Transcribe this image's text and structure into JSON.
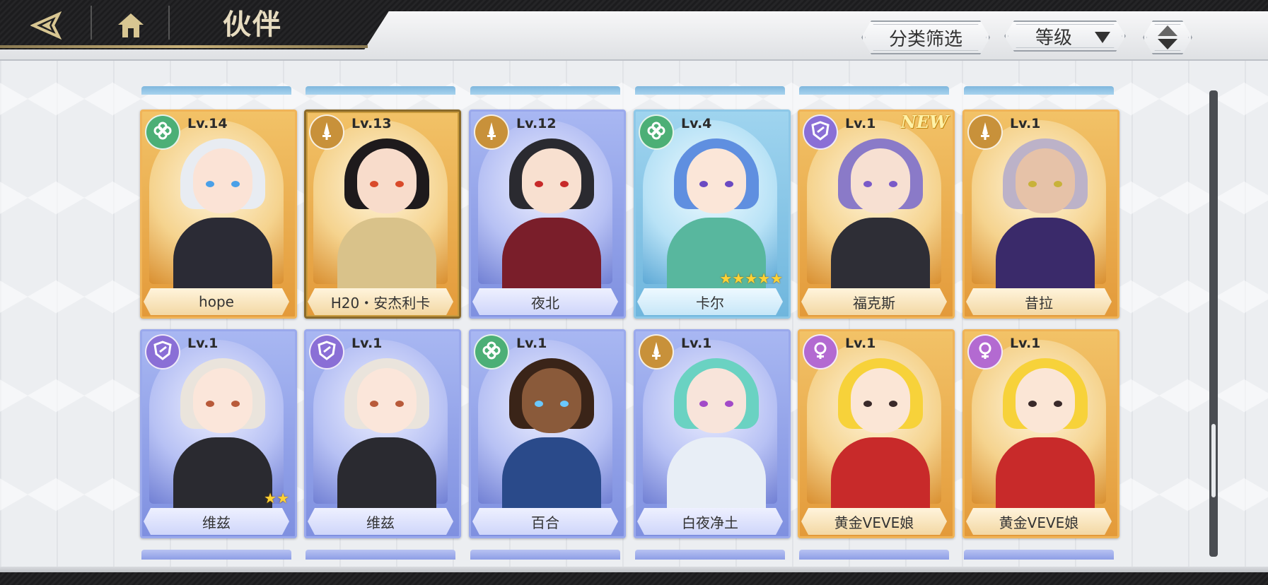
{
  "header": {
    "title": "伙伴",
    "filter_label": "分类筛选",
    "sort_label": "等级",
    "back_icon": "back-arrow-icon",
    "home_icon": "home-icon",
    "order_icon": "sort-order-icon"
  },
  "colors": {
    "gold_card": "#e9a84a",
    "blue_card": "#8e9ee6",
    "cyan_card": "#7fbfe3",
    "badge_green": "#4caf76",
    "badge_gold": "#c8913a",
    "badge_purple": "#8a6fd6",
    "badge_pink": "#b36ad1"
  },
  "partners": {
    "row1": [
      {
        "name": "hope",
        "level": "Lv.14",
        "rarity": "gold",
        "class_icon": "clover-icon",
        "hair": "#e8ecf2",
        "skin": "#fbe3d6",
        "body": "#2b2b35",
        "eyes": "#4aa0e8"
      },
      {
        "name": "H20・安杰利卡",
        "level": "Lv.13",
        "rarity": "gold",
        "class_icon": "sword-icon",
        "hair": "#1e1a1c",
        "skin": "#f8dccb",
        "body": "#d9c28a",
        "eyes": "#d94a2a"
      },
      {
        "name": "夜北",
        "level": "Lv.12",
        "rarity": "blue",
        "class_icon": "sword-icon",
        "hair": "#2a2a30",
        "skin": "#f8e0d0",
        "body": "#7a1e2a",
        "eyes": "#c72a2a"
      },
      {
        "name": "卡尔",
        "level": "Lv.4",
        "rarity": "cyan",
        "class_icon": "clover-icon",
        "hair": "#5f8fe0",
        "skin": "#fbe6d8",
        "body": "#58b79e",
        "eyes": "#6a4ac2",
        "stars": "★★★★★"
      },
      {
        "name": "福克斯",
        "level": "Lv.1",
        "rarity": "gold",
        "class_icon": "shield-icon",
        "hair": "#8a7ac8",
        "skin": "#f7e0d2",
        "body": "#2e2e36",
        "eyes": "#7a5ac8",
        "new": "NEW"
      },
      {
        "name": "昔拉",
        "level": "Lv.1",
        "rarity": "gold",
        "class_icon": "sword-icon",
        "hair": "#bcb2c8",
        "skin": "#e6c2a8",
        "body": "#3a2a6a",
        "eyes": "#c8b23a"
      }
    ],
    "row2": [
      {
        "name": "维兹",
        "level": "Lv.1",
        "rarity": "blue",
        "class_icon": "shield-icon",
        "hair": "#eae4dc",
        "skin": "#fbe6da",
        "body": "#2a2a30",
        "eyes": "#b85a3a",
        "stars": "★★"
      },
      {
        "name": "维兹",
        "level": "Lv.1",
        "rarity": "blue",
        "class_icon": "shield-icon",
        "hair": "#eae4dc",
        "skin": "#fbe6da",
        "body": "#2a2a30",
        "eyes": "#b85a3a"
      },
      {
        "name": "百合",
        "level": "Lv.1",
        "rarity": "blue",
        "class_icon": "clover-icon",
        "hair": "#3a2418",
        "skin": "#8a5a3a",
        "body": "#2a4a8a",
        "eyes": "#6ac8ff"
      },
      {
        "name": "白夜净土",
        "level": "Lv.1",
        "rarity": "blue",
        "class_icon": "sword-icon",
        "hair": "#6ad2c2",
        "skin": "#f8e4da",
        "body": "#e8eef6",
        "eyes": "#a24ac8"
      },
      {
        "name": "黄金VEVE娘",
        "level": "Lv.1",
        "rarity": "gold",
        "class_icon": "venus-icon",
        "hair": "#f7d23a",
        "skin": "#fbe6d6",
        "body": "#c82a2a",
        "eyes": "#3a2a2a"
      },
      {
        "name": "黄金VEVE娘",
        "level": "Lv.1",
        "rarity": "gold",
        "class_icon": "venus-icon",
        "hair": "#f7d23a",
        "skin": "#fbe6d6",
        "body": "#c82a2a",
        "eyes": "#3a2a2a"
      }
    ]
  }
}
